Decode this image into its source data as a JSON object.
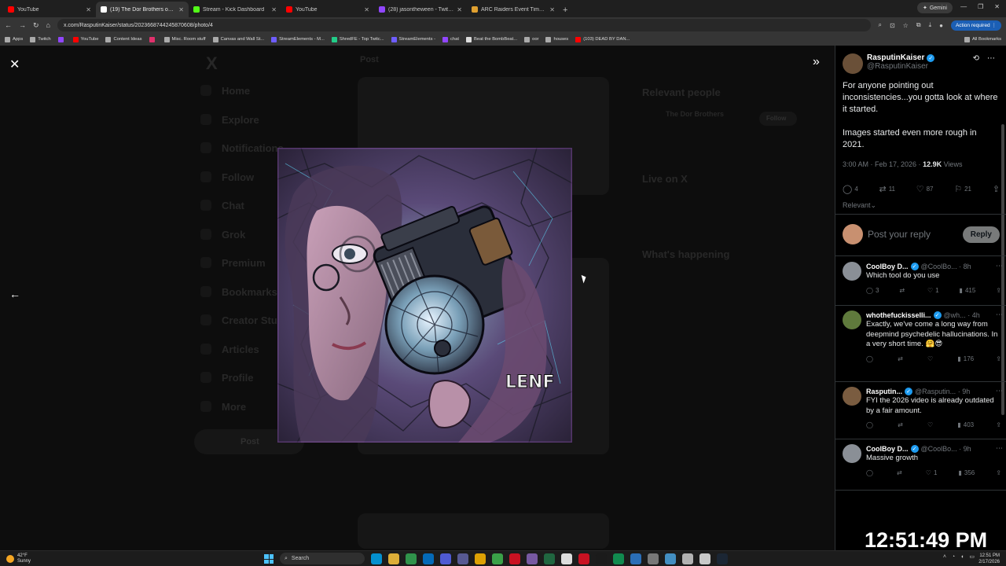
{
  "browser": {
    "tabs": [
      {
        "title": "YouTube",
        "color": "#ff0000",
        "active": false
      },
      {
        "title": "(19) The Dor Brothers on X: \"W",
        "color": "#ffffff",
        "active": true
      },
      {
        "title": "Stream - Kick Dashboard",
        "color": "#53fc18",
        "active": false
      },
      {
        "title": "YouTube",
        "color": "#ff0000",
        "active": false
      },
      {
        "title": "(28) jasontheween - Twitch",
        "color": "#9146ff",
        "active": false
      },
      {
        "title": "ARC Raiders Event Timers | Me",
        "color": "#e0a030",
        "active": false
      }
    ],
    "gemini_label": "Gemini",
    "url": "x.com/RasputinKaiser/status/2023668744245870608/photo/4",
    "action_required": "Action required",
    "bookmarks": [
      {
        "label": "Apps",
        "color": "#aaaaaa"
      },
      {
        "label": "Twitch",
        "color": "#aaaaaa"
      },
      {
        "label": "",
        "color": "#9146ff"
      },
      {
        "label": "YouTube",
        "color": "#ff0000"
      },
      {
        "label": "Content Ideas",
        "color": "#aaaaaa"
      },
      {
        "label": "",
        "color": "#e1306c"
      },
      {
        "label": "Misc. Room stuff",
        "color": "#aaaaaa"
      },
      {
        "label": "Canvas and Wall St...",
        "color": "#aaaaaa"
      },
      {
        "label": "StreamElements - M...",
        "color": "#6e5dff"
      },
      {
        "label": "ShredFE - Top Twitc...",
        "color": "#22cc88"
      },
      {
        "label": "StreamElements -",
        "color": "#6e5dff"
      },
      {
        "label": "chat",
        "color": "#9146ff"
      },
      {
        "label": "Beat the BombBeat...",
        "color": "#dddddd"
      },
      {
        "label": "oor",
        "color": "#aaaaaa"
      },
      {
        "label": "houses",
        "color": "#aaaaaa"
      },
      {
        "label": "(103) DEAD BY DAN...",
        "color": "#ff0000"
      }
    ],
    "all_bookmarks": "All Bookmarks"
  },
  "background_page": {
    "nav_items": [
      "Home",
      "Explore",
      "Notifications",
      "Follow",
      "Chat",
      "Grok",
      "Premium",
      "Bookmarks",
      "Creator Studio",
      "Articles",
      "Profile",
      "More"
    ],
    "post_button": "Post",
    "post_header": "Post",
    "relevant_people": "Relevant people",
    "profile_name": "The Dor Brothers",
    "follow_button": "Follow",
    "live_on_x": "Live on X",
    "whats_happening": "What's happening"
  },
  "tweet": {
    "author_name": "RasputinKaiser",
    "author_handle": "@RasputinKaiser",
    "text_line1": "For anyone pointing out inconsistencies...you gotta look at where it started.",
    "text_line2": "Images started even more rough in 2021.",
    "time": "3:00 AM · Feb 17, 2026 · ",
    "views_count": "12.9K",
    "views_label": " Views",
    "replies": "4",
    "reposts": "11",
    "likes": "87",
    "bookmarks": "21",
    "sort_label": "Relevant",
    "reply_placeholder": "Post your reply",
    "reply_button": "Reply"
  },
  "replies": [
    {
      "name": "CoolBoy D...",
      "handle": "@CoolBo...",
      "time": "· 8h",
      "text": "Which tool do you use",
      "replies": "3",
      "reposts": "",
      "likes": "1",
      "views": "415",
      "avatar": "#8a8f96"
    },
    {
      "name": "whothefuckisselli...",
      "handle": "@wh...",
      "time": "· 4h",
      "text": "Exactly, we've come a long way from deepmind psychedelic hallucinations. In a very short time. 🤗😎",
      "replies": "",
      "reposts": "",
      "likes": "",
      "views": "176",
      "avatar": "#5f7a3c"
    },
    {
      "name": "Rasputin...",
      "handle": "@Rasputin...",
      "time": "· 9h",
      "text": "FYI the 2026 video is already outdated by a fair amount.",
      "replies": "",
      "reposts": "",
      "likes": "",
      "views": "403",
      "avatar": "#7a5c40"
    },
    {
      "name": "CoolBoy D...",
      "handle": "@CoolBo...",
      "time": "· 9h",
      "text": "Massive growth",
      "replies": "",
      "reposts": "",
      "likes": "1",
      "views": "356",
      "avatar": "#8a8f96"
    }
  ],
  "overlay_clock": "12:51:49 PM",
  "taskbar": {
    "temp": "42°F",
    "weather": "Sunny",
    "search": "Search",
    "time": "12:51 PM",
    "date": "2/17/2026",
    "app_colors": [
      "#00a4ef",
      "#ffc83d",
      "#34a853",
      "#0078d4",
      "#5865f2",
      "#6264a7",
      "#ffb900",
      "#3fb950",
      "#e81123",
      "#8764b8",
      "#217346",
      "#ffffff",
      "#e81123",
      "#1b1b1b",
      "#0f9d58",
      "#2d7dd2",
      "#888888",
      "#4aa3df",
      "#cccccc",
      "#e8e8e8",
      "#1b2838"
    ]
  }
}
